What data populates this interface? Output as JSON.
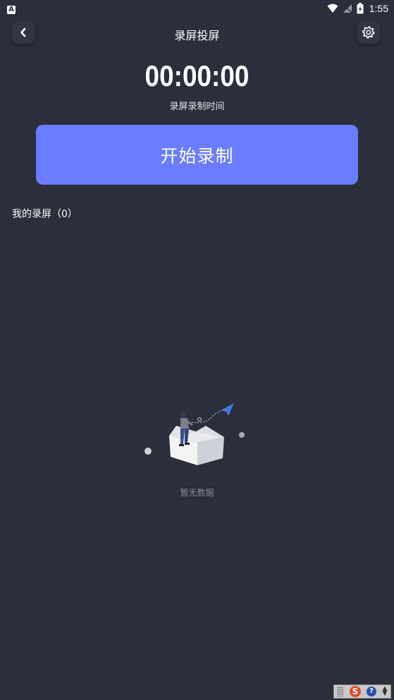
{
  "status_bar": {
    "left_icon_label": "A",
    "time": "1:55"
  },
  "header": {
    "title": "录屏投屏",
    "back_icon": "chevron-left-icon",
    "settings_icon": "gear-icon"
  },
  "timer": {
    "value": "00:00:00",
    "label": "录屏录制时间"
  },
  "start_button": {
    "label": "开始录制"
  },
  "recordings": {
    "title": "我的录屏（0）"
  },
  "empty_state": {
    "text": "暂无数据",
    "illustration": "empty-box-illustration"
  },
  "ime": {
    "s_label": "S",
    "help_label": "?"
  },
  "colors": {
    "background": "#2b2e3b",
    "accent": "#6a7cff"
  }
}
